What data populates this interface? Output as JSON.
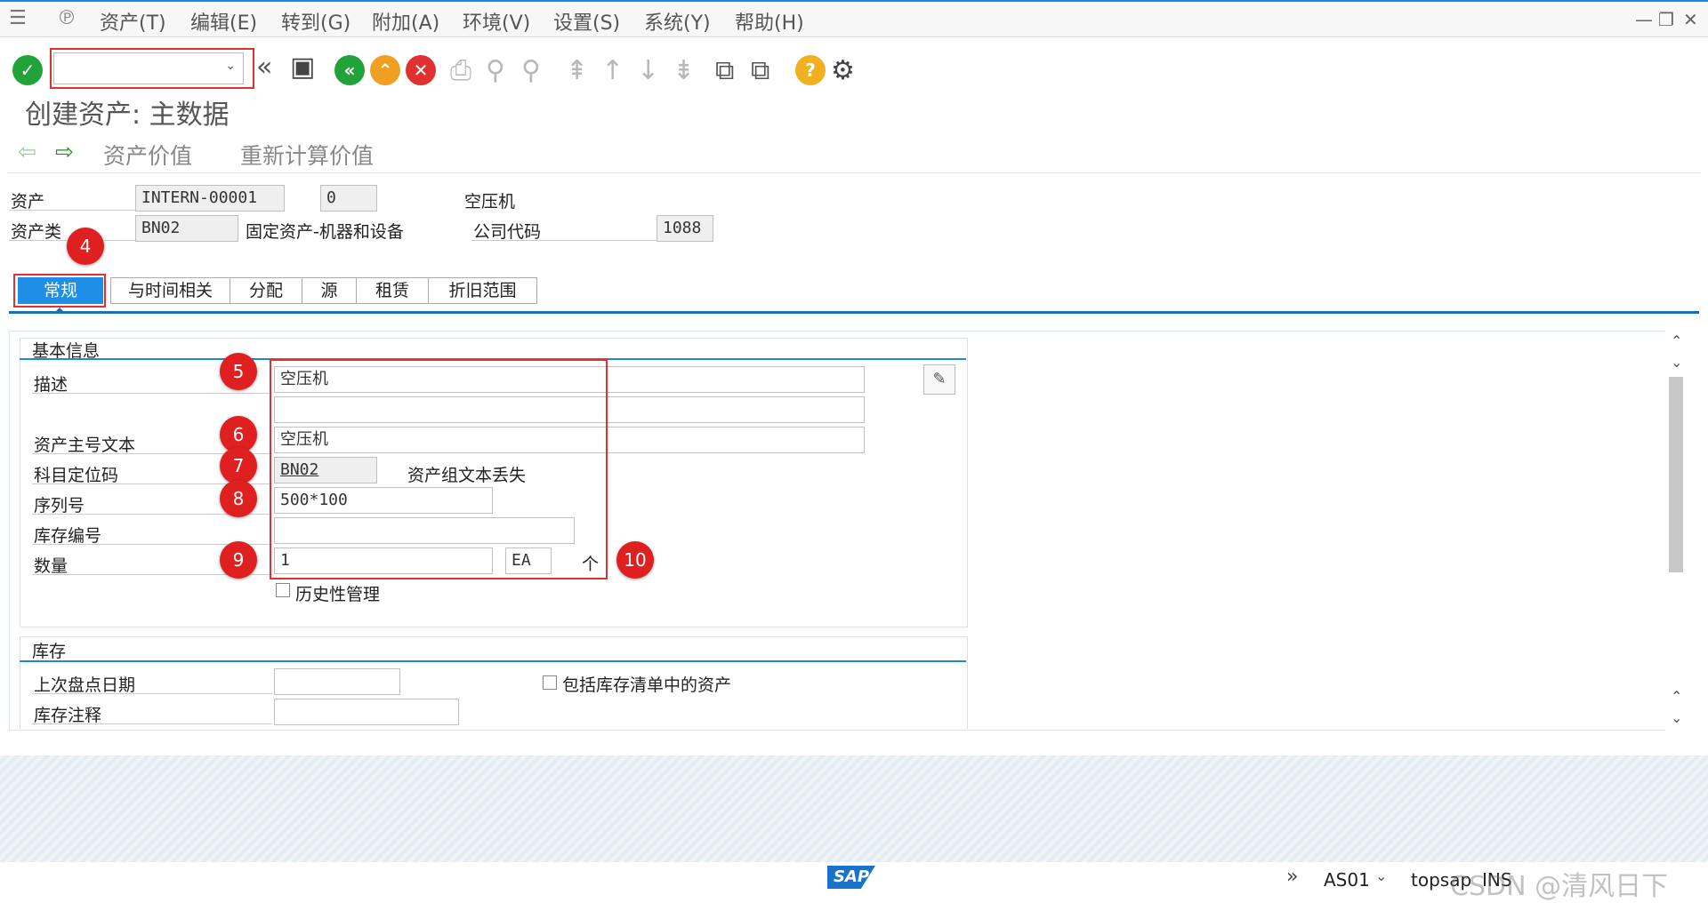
{
  "menu": [
    "资产(T)",
    "编辑(E)",
    "转到(G)",
    "附加(A)",
    "环境(V)",
    "设置(S)",
    "系统(Y)",
    "帮助(H)"
  ],
  "title": "创建资产: 主数据",
  "app_toolbar": {
    "asset_values": "资产价值",
    "recalc_values": "重新计算价值"
  },
  "header": {
    "asset_label": "资产",
    "asset_number": "INTERN-00001",
    "sub_number": "0",
    "asset_desc": "空压机",
    "asset_class_label": "资产类",
    "asset_class": "BN02",
    "asset_class_desc": "固定资产-机器和设备",
    "company_code_label": "公司代码",
    "company_code": "1088"
  },
  "tabs": [
    "常规",
    "与时间相关",
    "分配",
    "源",
    "租赁",
    "折旧范围"
  ],
  "general": {
    "group_title": "基本信息",
    "description_label": "描述",
    "description_1": "空压机",
    "description_2": "",
    "main_text_label": "资产主号文本",
    "main_text": "空压机",
    "account_det_label": "科目定位码",
    "account_det": "BN02",
    "account_det_note": "资产组文本丢失",
    "serial_label": "序列号",
    "serial": "500*100",
    "inventory_no_label": "库存编号",
    "inventory_no": "",
    "quantity_label": "数量",
    "quantity": "1",
    "unit": "EA",
    "unit_text": "个",
    "history_label": "历史性管理"
  },
  "inventory": {
    "group_title": "库存",
    "last_inv_label": "上次盘点日期",
    "last_inv_date": "",
    "inv_note_label": "库存注释",
    "inv_note": "",
    "include_label": "包括库存清单中的资产"
  },
  "badges": [
    "4",
    "5",
    "6",
    "7",
    "8",
    "9",
    "10"
  ],
  "status": {
    "logo": "SAP",
    "tcode": "AS01",
    "server": "topsap",
    "mode": "INS",
    "watermark": "CSDN @清风日下"
  },
  "colors": {
    "accent": "#1a8bd6",
    "tab_active": "#1f8ee6",
    "annotation": "#e02020"
  }
}
